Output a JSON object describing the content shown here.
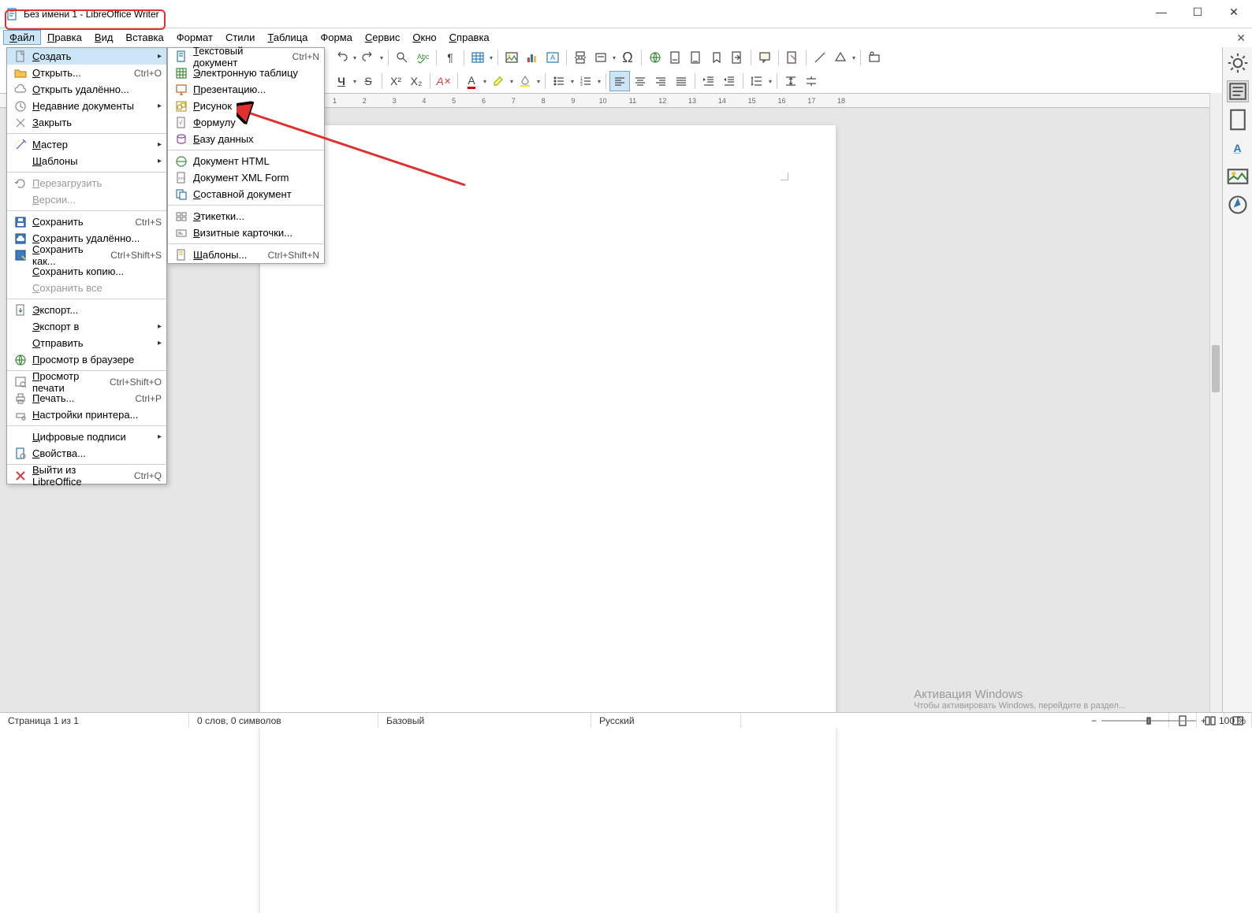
{
  "title": "Без имени 1 - LibreOffice Writer",
  "menubar": [
    "Файл",
    "Правка",
    "Вид",
    "Вставка",
    "Формат",
    "Стили",
    "Таблица",
    "Форма",
    "Сервис",
    "Окно",
    "Справка"
  ],
  "file_menu": {
    "items": [
      {
        "label": "Создать",
        "shortcut": "",
        "submenu": true,
        "highlight": true,
        "ico": "new"
      },
      {
        "label": "Открыть...",
        "shortcut": "Ctrl+O",
        "ico": "open"
      },
      {
        "label": "Открыть удалённо...",
        "ico": "cloud"
      },
      {
        "label": "Недавние документы",
        "submenu": true,
        "ico": "recent"
      },
      {
        "label": "Закрыть",
        "ico": "close"
      },
      {
        "sep": true
      },
      {
        "label": "Мастер",
        "submenu": true,
        "ico": "wizard"
      },
      {
        "label": "Шаблоны",
        "submenu": true
      },
      {
        "sep": true
      },
      {
        "label": "Перезагрузить",
        "disabled": true,
        "ico": "reload"
      },
      {
        "label": "Версии...",
        "disabled": true
      },
      {
        "sep": true
      },
      {
        "label": "Сохранить",
        "shortcut": "Ctrl+S",
        "ico": "save"
      },
      {
        "label": "Сохранить удалённо...",
        "ico": "savecloud"
      },
      {
        "label": "Сохранить как...",
        "shortcut": "Ctrl+Shift+S",
        "ico": "saveas"
      },
      {
        "label": "Сохранить копию..."
      },
      {
        "label": "Сохранить все",
        "disabled": true
      },
      {
        "sep": true
      },
      {
        "label": "Экспорт...",
        "ico": "export"
      },
      {
        "label": "Экспорт в",
        "submenu": true
      },
      {
        "label": "Отправить",
        "submenu": true
      },
      {
        "label": "Просмотр в браузере",
        "ico": "globe"
      },
      {
        "sep": true
      },
      {
        "label": "Просмотр печати",
        "shortcut": "Ctrl+Shift+O",
        "ico": "preview"
      },
      {
        "label": "Печать...",
        "shortcut": "Ctrl+P",
        "ico": "print"
      },
      {
        "label": "Настройки принтера...",
        "ico": "printset"
      },
      {
        "sep": true
      },
      {
        "label": "Цифровые подписи",
        "submenu": true
      },
      {
        "label": "Свойства...",
        "ico": "props"
      },
      {
        "sep": true
      },
      {
        "label": "Выйти из LibreOffice",
        "shortcut": "Ctrl+Q",
        "ico": "exit"
      }
    ]
  },
  "new_submenu": [
    {
      "label": "Текстовый документ",
      "shortcut": "Ctrl+N",
      "ico": "doc"
    },
    {
      "label": "Электронную таблицу",
      "ico": "calc"
    },
    {
      "label": "Презентацию...",
      "ico": "impress"
    },
    {
      "label": "Рисунок",
      "ico": "draw"
    },
    {
      "label": "Формулу",
      "ico": "math"
    },
    {
      "label": "Базу данных",
      "ico": "base"
    },
    {
      "sep": true
    },
    {
      "label": "Документ HTML",
      "ico": "html"
    },
    {
      "label": "Документ XML Form",
      "ico": "xml"
    },
    {
      "label": "Составной документ",
      "ico": "master"
    },
    {
      "sep": true
    },
    {
      "label": "Этикетки...",
      "ico": "labels"
    },
    {
      "label": "Визитные карточки...",
      "ico": "bcard"
    },
    {
      "sep": true
    },
    {
      "label": "Шаблоны...",
      "shortcut": "Ctrl+Shift+N",
      "ico": "tmpl"
    }
  ],
  "ruler": [
    "1",
    "",
    "1",
    "2",
    "3",
    "4",
    "5",
    "6",
    "7",
    "8",
    "9",
    "10",
    "11",
    "12",
    "13",
    "14",
    "15",
    "16",
    "17",
    "18"
  ],
  "status": {
    "page": "Страница 1 из 1",
    "words": "0 слов, 0 символов",
    "style": "Базовый",
    "lang": "Русский",
    "zoom": "100 %"
  },
  "watermark": {
    "line1": "Активация Windows",
    "line2": "Чтобы активировать Windows, перейдите в раздел..."
  }
}
